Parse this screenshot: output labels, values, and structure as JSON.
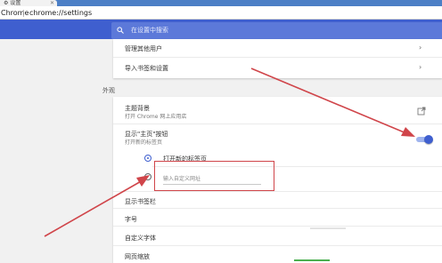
{
  "browser": {
    "tab_title": "设置",
    "address_scheme": "Chrome",
    "address_url": "chrome://settings"
  },
  "header": {
    "search_placeholder": "在设置中搜索"
  },
  "people_card": {
    "items": [
      {
        "label": "管理其他用户"
      },
      {
        "label": "导入书签和设置"
      }
    ]
  },
  "appearance": {
    "section_title": "外观",
    "theme": {
      "title": "主题背景",
      "subtitle": "打开 Chrome 网上应用店"
    },
    "home_button": {
      "title": "显示\"主页\"按钮",
      "subtitle": "打开新的标签页",
      "enabled": true
    },
    "home_options": {
      "new_tab_label": "打开新的标签页",
      "custom_url_placeholder": "输入自定义网址",
      "selected": "new_tab"
    },
    "bookmarks_bar": {
      "title": "显示书签栏"
    },
    "font_size": {
      "title": "字号"
    },
    "custom_fonts": {
      "title": "自定义字体"
    },
    "page_zoom": {
      "title": "网页缩放"
    }
  },
  "colors": {
    "accent": "#3f5fcf",
    "annotation_red": "#d0454a"
  }
}
